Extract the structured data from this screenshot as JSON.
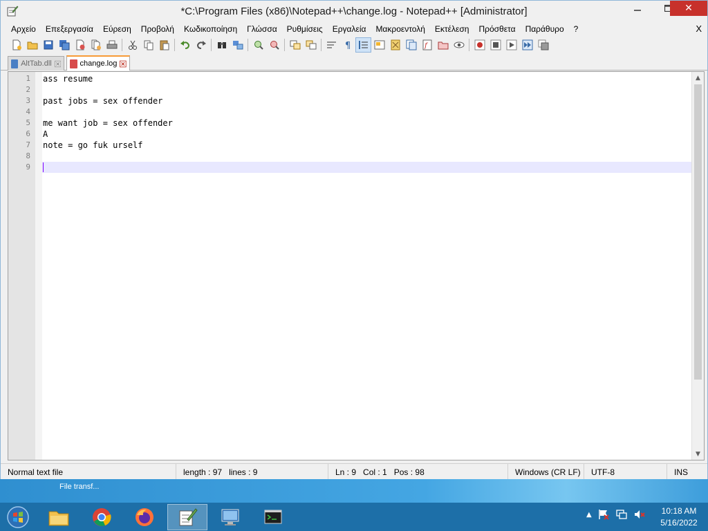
{
  "window": {
    "title": "*C:\\Program Files (x86)\\Notepad++\\change.log - Notepad++ [Administrator]",
    "close_glyph": "✕"
  },
  "menu": {
    "items": [
      "Αρχείο",
      "Επεξεργασία",
      "Εύρεση",
      "Προβολή",
      "Κωδικοποίηση",
      "Γλώσσα",
      "Ρυθμίσεις",
      "Εργαλεία",
      "Μακροεντολή",
      "Εκτέλεση",
      "Πρόσθετα",
      "Παράθυρο",
      "?"
    ],
    "close_doc": "X"
  },
  "tabs": [
    {
      "label": "AltTab.dll",
      "active": false
    },
    {
      "label": "change.log",
      "active": true
    }
  ],
  "editor": {
    "lines": [
      {
        "num": "1",
        "text": "ass resume"
      },
      {
        "num": "2",
        "text": ""
      },
      {
        "num": "3",
        "text": "past jobs = sex offender"
      },
      {
        "num": "4",
        "text": ""
      },
      {
        "num": "5",
        "text": "me want job = sex offender"
      },
      {
        "num": "6",
        "text": "A"
      },
      {
        "num": "7",
        "text": "note = go fuk urself"
      },
      {
        "num": "8",
        "text": ""
      },
      {
        "num": "9",
        "text": ""
      }
    ],
    "current_line": 9
  },
  "status": {
    "file_type": "Normal text file",
    "length": "length : 97",
    "lines": "lines : 9",
    "ln": "Ln : 9",
    "col": "Col : 1",
    "pos": "Pos : 98",
    "eol": "Windows (CR LF)",
    "encoding": "UTF-8",
    "mode": "INS"
  },
  "notification": {
    "text": "File transf..."
  },
  "taskbar": {
    "apps": [
      "file-explorer",
      "chrome",
      "firefox",
      "notepad-plus-plus",
      "remote-desktop",
      "terminal"
    ],
    "active_app": "notepad-plus-plus"
  },
  "clock": {
    "time": "10:18 AM",
    "date": "5/16/2022"
  },
  "colors": {
    "close_button": "#c7312b",
    "current_line": "#e8e8ff",
    "caret": "#8000ff",
    "tab_accent": "#f79a36",
    "taskbar": "#1d6fa8"
  }
}
